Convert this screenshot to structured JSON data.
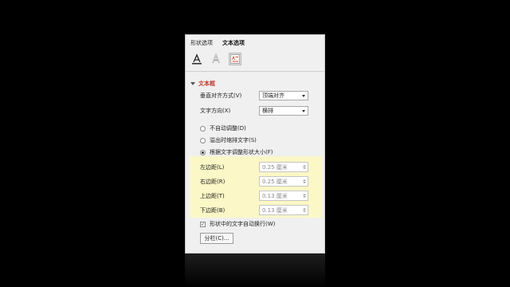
{
  "tabs": [
    {
      "label": "形状选项",
      "active": false
    },
    {
      "label": "文本选项",
      "active": true
    }
  ],
  "icon_tabs": [
    "text-fill-outline-icon",
    "text-effects-icon",
    "textbox-layout-icon"
  ],
  "section": {
    "title": "文本框"
  },
  "fields": {
    "vertical_align": {
      "label": "垂直对齐方式(V)",
      "value": "顶端对齐"
    },
    "text_direction": {
      "label": "文字方向(X)",
      "value": "横排"
    }
  },
  "autofit": [
    {
      "label": "不自动调整(D)",
      "selected": false
    },
    {
      "label": "溢出时缩排文字(S)",
      "selected": false
    },
    {
      "label": "根据文字调整形状大小(F)",
      "selected": true
    }
  ],
  "margins": [
    {
      "label": "左边距(L)",
      "value": "0.25 厘米"
    },
    {
      "label": "右边距(R)",
      "value": "0.25 厘米"
    },
    {
      "label": "上边距(T)",
      "value": "0.13 厘米"
    },
    {
      "label": "下边距(B)",
      "value": "0.13 厘米"
    }
  ],
  "wrap": {
    "label": "形状中的文字自动换行(W)",
    "checked": true,
    "mark": "✓"
  },
  "columns_button": {
    "label": "分栏(C)..."
  },
  "colors": {
    "highlight": "#fbf7c6",
    "section_title": "#c0392b",
    "accent_icon": "#d04a2a"
  }
}
